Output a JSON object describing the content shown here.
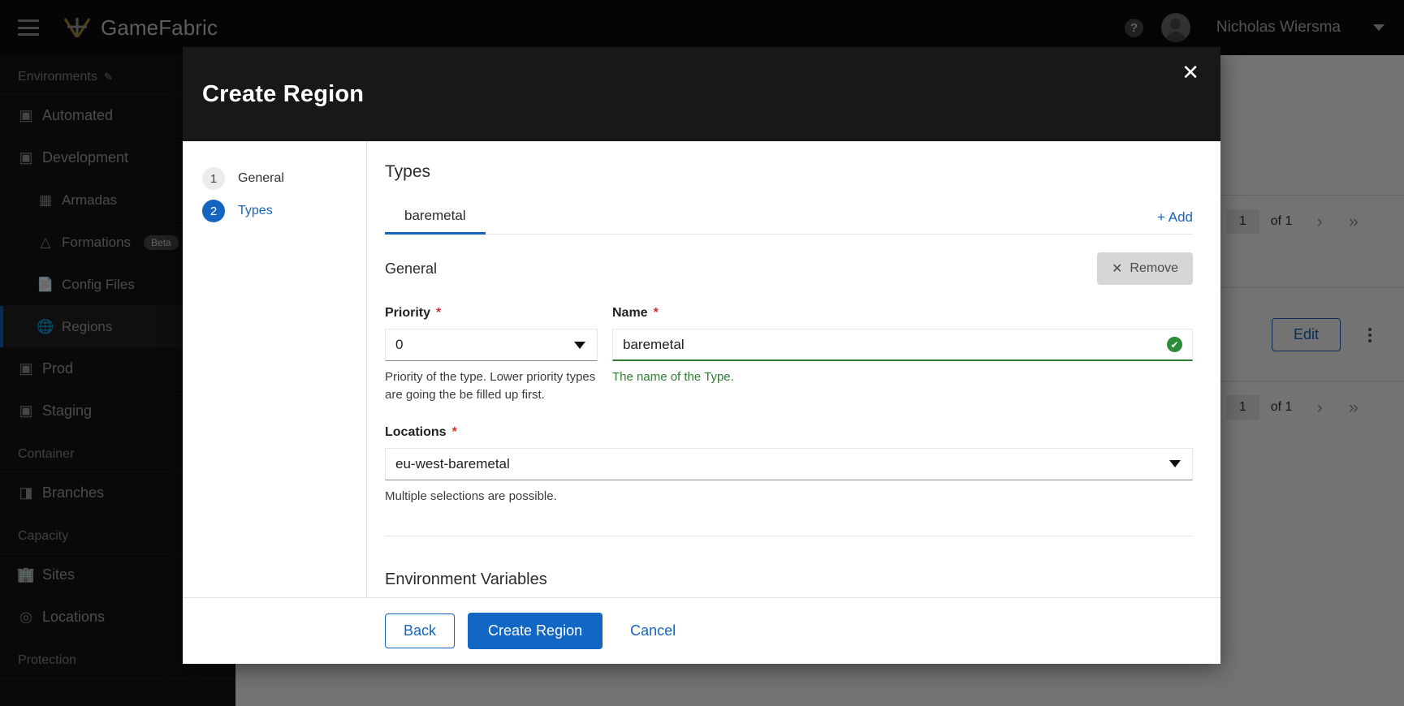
{
  "topbar": {
    "menu_icon": "hamburger-icon",
    "brand": "GameFabric",
    "help_icon": "?",
    "user_name": "Nicholas Wiersma",
    "caret_icon": "chevron-down-icon"
  },
  "sidebar": {
    "sections": [
      {
        "label": "Environments",
        "edit_icon": "pencil-icon"
      },
      {
        "label": "Container"
      },
      {
        "label": "Capacity"
      },
      {
        "label": "Protection"
      }
    ],
    "items": [
      {
        "label": "Automated",
        "icon": "environment-icon"
      },
      {
        "label": "Development",
        "icon": "environment-icon"
      },
      {
        "label": "Armadas",
        "icon": "armada-icon"
      },
      {
        "label": "Formations",
        "icon": "formation-icon",
        "badge": "Beta"
      },
      {
        "label": "Config Files",
        "icon": "file-icon"
      },
      {
        "label": "Regions",
        "icon": "globe-icon"
      },
      {
        "label": "Prod",
        "icon": "environment-icon"
      },
      {
        "label": "Staging",
        "icon": "environment-icon"
      },
      {
        "label": "Branches",
        "icon": "branches-icon"
      },
      {
        "label": "Sites",
        "icon": "sites-icon"
      },
      {
        "label": "Locations",
        "icon": "locations-icon"
      }
    ]
  },
  "background": {
    "pager_top": {
      "prev": "‹",
      "page": "1",
      "of": "of 1",
      "next": "›",
      "last": "»"
    },
    "edit_label": "Edit",
    "kebab_icon": "more-vertical-icon",
    "pager_bottom": {
      "prev": "‹",
      "page": "1",
      "of": "of 1",
      "next": "›",
      "last": "»"
    }
  },
  "modal": {
    "title": "Create Region",
    "close_icon": "✕",
    "steps": [
      {
        "number": "1",
        "label": "General",
        "active": false
      },
      {
        "number": "2",
        "label": "Types",
        "active": true
      }
    ],
    "section_title": "Types",
    "tabs": [
      {
        "label": "baremetal",
        "active": true
      }
    ],
    "add_label": "+ Add",
    "subsection_title": "General",
    "remove_label": "Remove",
    "remove_icon": "✕",
    "fields": {
      "priority": {
        "label": "Priority",
        "required": "*",
        "value": "0",
        "hint": "Priority of the type. Lower priority types are going the be filled up first.",
        "control": "select"
      },
      "name": {
        "label": "Name",
        "required": "*",
        "value": "baremetal",
        "hint": "The name of the Type.",
        "control": "text",
        "valid_icon": "✔"
      },
      "locations": {
        "label": "Locations",
        "required": "*",
        "value": "eu-west-baremetal",
        "hint": "Multiple selections are possible.",
        "control": "multiselect"
      }
    },
    "next_section_title": "Environment Variables",
    "footer": {
      "back": "Back",
      "submit": "Create Region",
      "cancel": "Cancel"
    }
  },
  "colors": {
    "accent": "#1565c0",
    "primary_button": "#1266c4",
    "valid_green": "#2e7d32",
    "required_red": "#d32f2f",
    "topbar_bg": "#0d0d0d",
    "sidebar_bg": "#161616",
    "modal_head_bg": "#181818",
    "brand_gold": "#a8842a"
  }
}
